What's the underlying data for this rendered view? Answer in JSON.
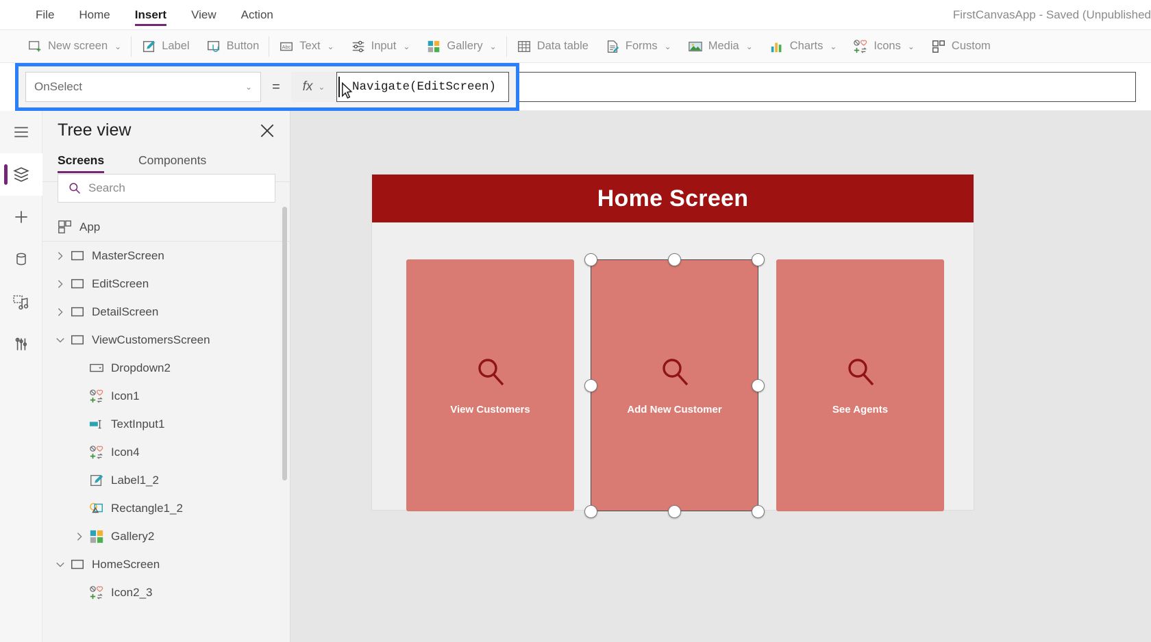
{
  "titlebar": {
    "menu": [
      {
        "label": "File",
        "active": false
      },
      {
        "label": "Home",
        "active": false
      },
      {
        "label": "Insert",
        "active": true
      },
      {
        "label": "View",
        "active": false
      },
      {
        "label": "Action",
        "active": false
      }
    ],
    "app_title": "FirstCanvasApp - Saved (Unpublished"
  },
  "ribbon": {
    "items": [
      {
        "label": "New screen",
        "icon": "new-screen-icon",
        "caret": true
      },
      {
        "label": "Label",
        "icon": "label-icon",
        "caret": false
      },
      {
        "label": "Button",
        "icon": "button-icon",
        "caret": false
      },
      {
        "label": "Text",
        "icon": "text-icon",
        "caret": true
      },
      {
        "label": "Input",
        "icon": "input-icon",
        "caret": true
      },
      {
        "label": "Gallery",
        "icon": "gallery-icon",
        "caret": true
      },
      {
        "label": "Data table",
        "icon": "data-table-icon",
        "caret": false
      },
      {
        "label": "Forms",
        "icon": "forms-icon",
        "caret": true
      },
      {
        "label": "Media",
        "icon": "media-icon",
        "caret": true
      },
      {
        "label": "Charts",
        "icon": "charts-icon",
        "caret": true
      },
      {
        "label": "Icons",
        "icon": "icons-icon",
        "caret": true
      },
      {
        "label": "Custom",
        "icon": "custom-icon",
        "caret": false
      }
    ]
  },
  "formula_bar": {
    "property": "OnSelect",
    "equals": "=",
    "fx": "fx",
    "value": "Navigate(EditScreen)"
  },
  "rail": {
    "items": [
      {
        "name": "hamburger-menu-icon",
        "active": false
      },
      {
        "name": "tree-view-icon",
        "active": true
      },
      {
        "name": "insert-icon",
        "active": false
      },
      {
        "name": "data-icon",
        "active": false
      },
      {
        "name": "media-library-icon",
        "active": false
      },
      {
        "name": "advanced-tools-icon",
        "active": false
      }
    ]
  },
  "tree_view": {
    "title": "Tree view",
    "tabs": [
      {
        "label": "Screens",
        "active": true
      },
      {
        "label": "Components",
        "active": false
      }
    ],
    "search_placeholder": "Search",
    "items": [
      {
        "label": "App",
        "icon": "app-icon",
        "indent": 0,
        "twisty": "none"
      },
      {
        "label": "MasterScreen",
        "icon": "screen-icon",
        "indent": 0,
        "twisty": "collapsed"
      },
      {
        "label": "EditScreen",
        "icon": "screen-icon",
        "indent": 0,
        "twisty": "collapsed"
      },
      {
        "label": "DetailScreen",
        "icon": "screen-icon",
        "indent": 0,
        "twisty": "collapsed"
      },
      {
        "label": "ViewCustomersScreen",
        "icon": "screen-icon",
        "indent": 0,
        "twisty": "expanded"
      },
      {
        "label": "Dropdown2",
        "icon": "dropdown-icon",
        "indent": 1,
        "twisty": "none"
      },
      {
        "label": "Icon1",
        "icon": "icons-icon",
        "indent": 1,
        "twisty": "none"
      },
      {
        "label": "TextInput1",
        "icon": "text-input-icon",
        "indent": 1,
        "twisty": "none"
      },
      {
        "label": "Icon4",
        "icon": "icons-icon",
        "indent": 1,
        "twisty": "none"
      },
      {
        "label": "Label1_2",
        "icon": "label-icon",
        "indent": 1,
        "twisty": "none"
      },
      {
        "label": "Rectangle1_2",
        "icon": "shape-icon",
        "indent": 1,
        "twisty": "none"
      },
      {
        "label": "Gallery2",
        "icon": "gallery-icon",
        "indent": 1,
        "twisty": "collapsed"
      },
      {
        "label": "HomeScreen",
        "icon": "screen-icon",
        "indent": 0,
        "twisty": "expanded"
      },
      {
        "label": "Icon2_3",
        "icon": "icons-icon",
        "indent": 1,
        "twisty": "none"
      }
    ]
  },
  "canvas": {
    "header_title": "Home Screen",
    "header_color": "#9e1212",
    "card_color": "#d97b72",
    "cards": [
      {
        "label": "View Customers",
        "icon": "search-icon",
        "selected": false
      },
      {
        "label": "Add New Customer",
        "icon": "search-icon",
        "selected": true
      },
      {
        "label": "See Agents",
        "icon": "search-icon",
        "selected": false
      }
    ]
  }
}
